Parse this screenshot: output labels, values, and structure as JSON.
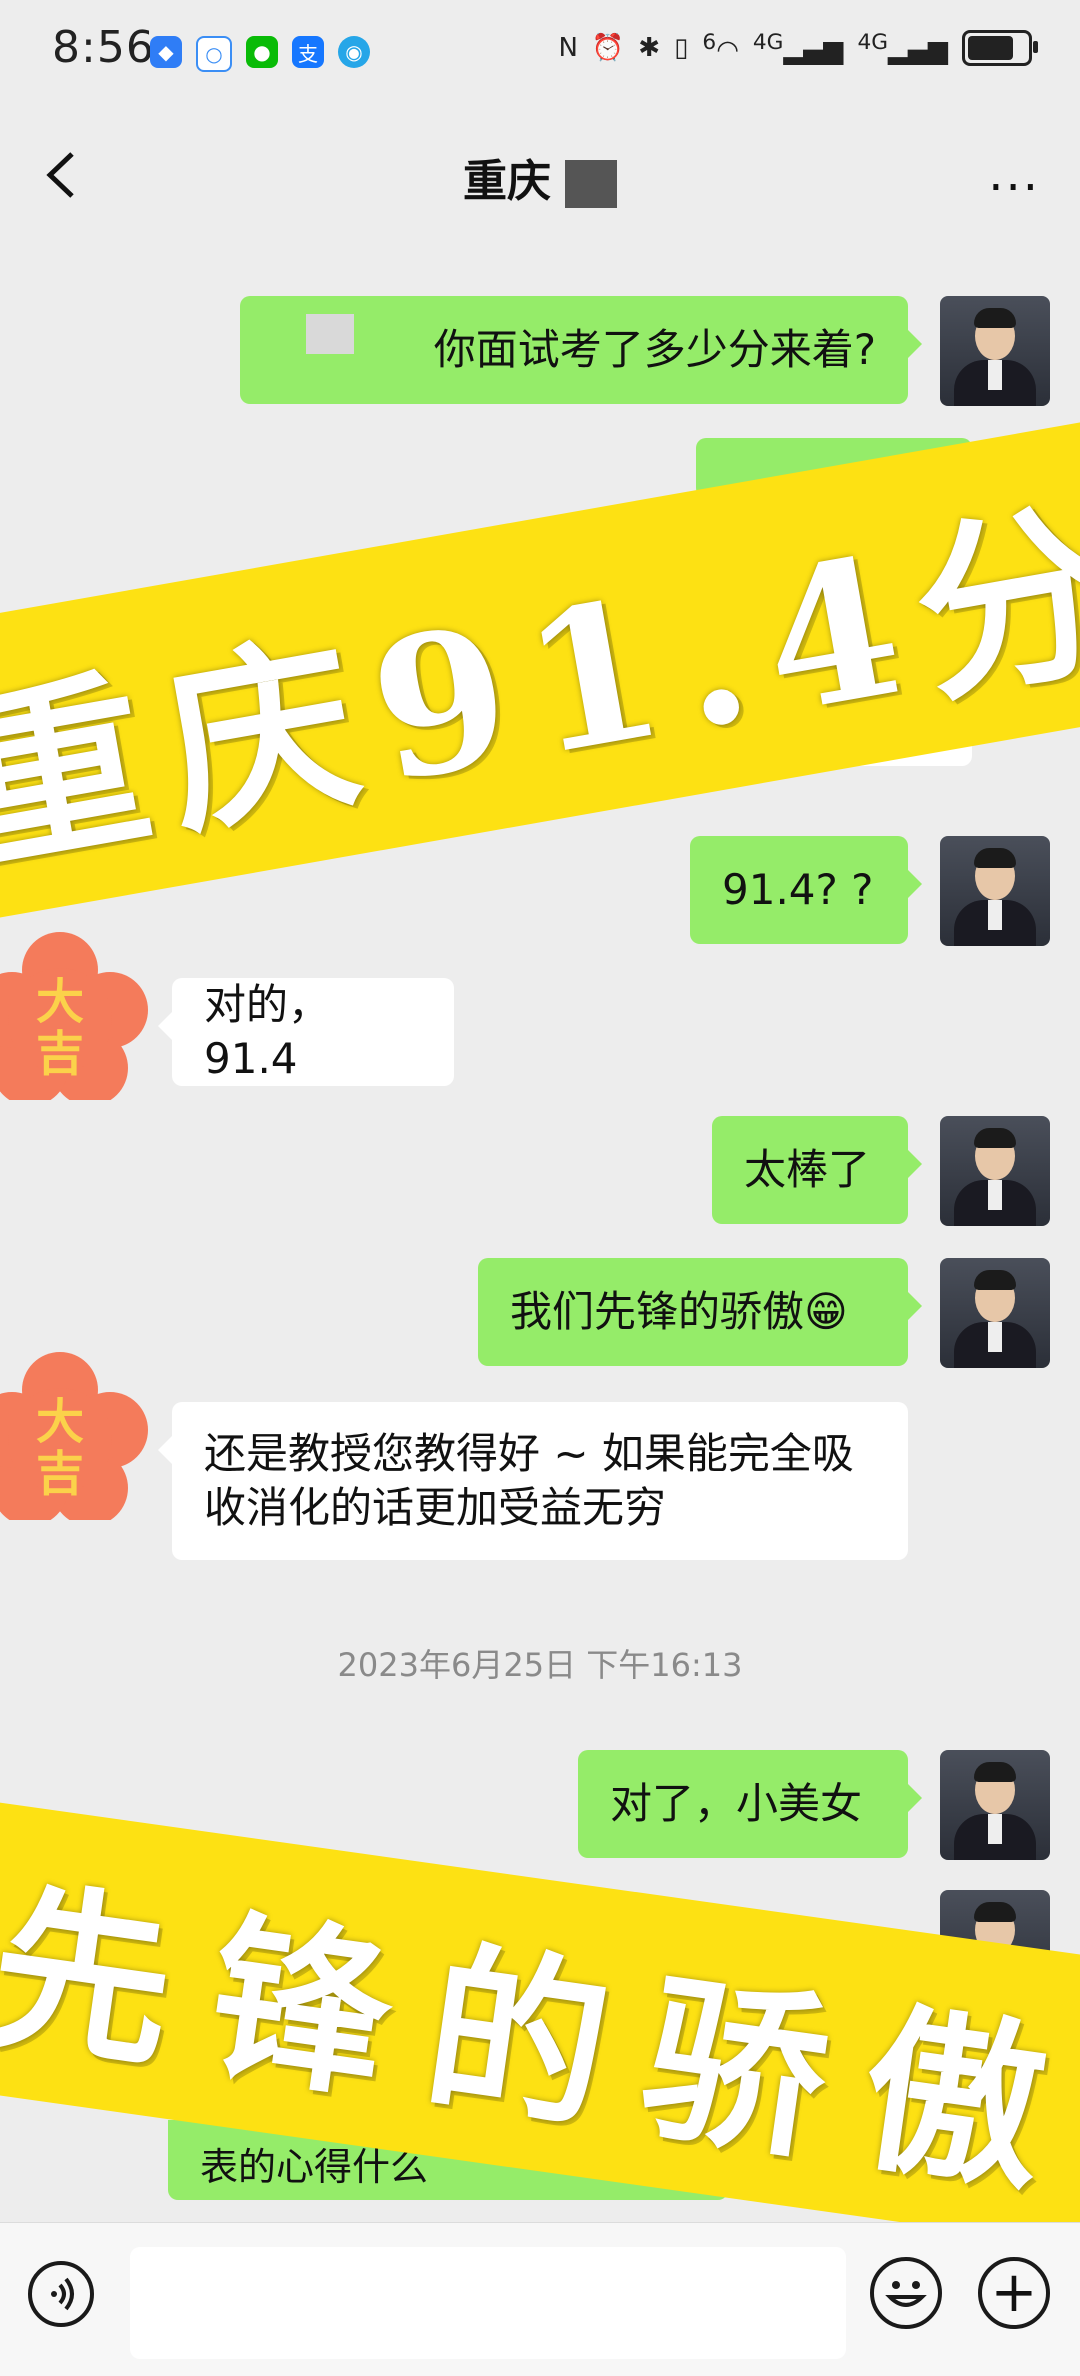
{
  "status_bar": {
    "time": "8:56",
    "network_labels": [
      "6",
      "4G",
      "4G"
    ],
    "battery_level": 0.8
  },
  "header": {
    "title": "重庆"
  },
  "messages": [
    {
      "dir": "out",
      "text": "你面试考了多少分来着?"
    },
    {
      "dir": "out",
      "text": "91.4? ?"
    },
    {
      "dir": "in",
      "text": "对的，91.4"
    },
    {
      "dir": "out",
      "text": "太棒了"
    },
    {
      "dir": "out",
      "text": "我们先锋的骄傲😁"
    },
    {
      "dir": "in",
      "text": "还是教授您教得好 ~ 如果能完全吸收消化的话更加受益无穷"
    },
    {
      "dir": "out",
      "text": "对了，小美女"
    }
  ],
  "timestamp": "2023年6月25日 下午16:13",
  "partial_text": "表的心得什么",
  "overlays": {
    "banner_top": "重庆91.4分",
    "banner_bottom": "先锋的骄傲"
  },
  "contact_avatar_text": "大吉",
  "colors": {
    "outgoing_bubble": "#95ec69",
    "incoming_bubble": "#ffffff",
    "banner": "#fde113",
    "flower": "#f47b5b",
    "flower_text": "#fbd24a"
  }
}
